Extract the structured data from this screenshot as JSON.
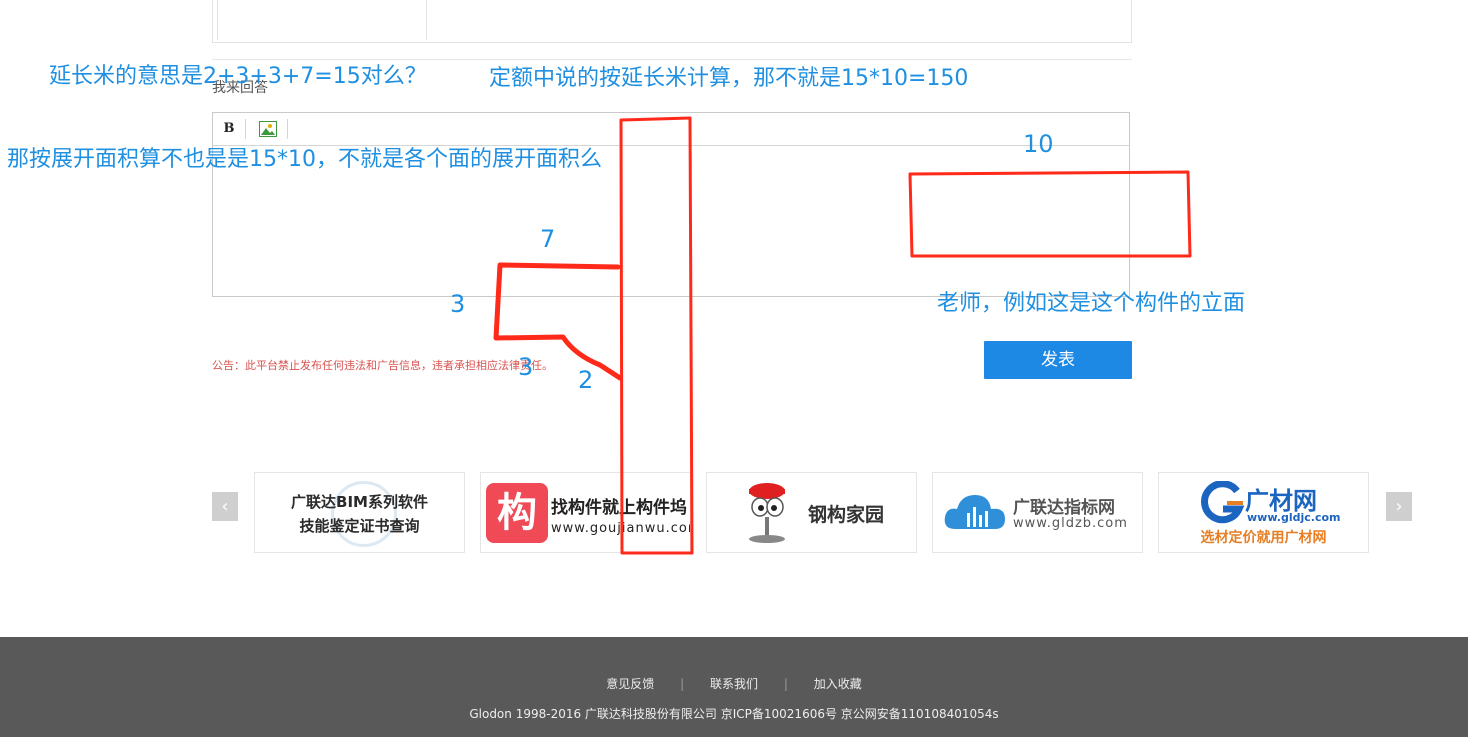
{
  "editor": {
    "answer_label": "我来回答",
    "bold_label": "B"
  },
  "notice": "公告：此平台禁止发布任何违法和广告信息，违者承担相应法律责任。",
  "publish_button": "发表",
  "partners": [
    {
      "line1": "广联达BIM系列软件",
      "line2": "技能鉴定证书查询"
    },
    {
      "logo_char": "构",
      "name": "找构件就上构件坞",
      "url": "www.goujianwu.com"
    },
    {
      "name": "钢构家园"
    },
    {
      "name": "广联达指标网",
      "url": "www.gldzb.com"
    },
    {
      "brand": "广材网",
      "url": "www.gldjc.com",
      "slogan": "选材定价就用广材网"
    }
  ],
  "carousel": {
    "prev": "‹",
    "next": "›"
  },
  "footer": {
    "links": [
      "意见反馈",
      "联系我们",
      "加入收藏"
    ],
    "separator": "|",
    "copyright": "Glodon 1998-2016 广联达科技股份有限公司 京ICP备10021606号 京公网安备110108401054s"
  },
  "annotations": {
    "note_1": "延长米的意思是2+3+3+7=15对么？",
    "note_2": "定额中说的按延长米计算，那不就是15*10=150",
    "note_3": "那按展开面积算不也是是15*10，不就是各个面的展开面积么",
    "note_4": "老师，例如这是这个构件的立面",
    "dim_10": "10",
    "dim_7": "7",
    "dim_3a": "3",
    "dim_3b": "3",
    "dim_2": "2"
  },
  "colors": {
    "annotation": "#1e8fe1",
    "markup": "#ff2a1a",
    "publish": "#1e88e5",
    "footer_bg": "#595959"
  }
}
